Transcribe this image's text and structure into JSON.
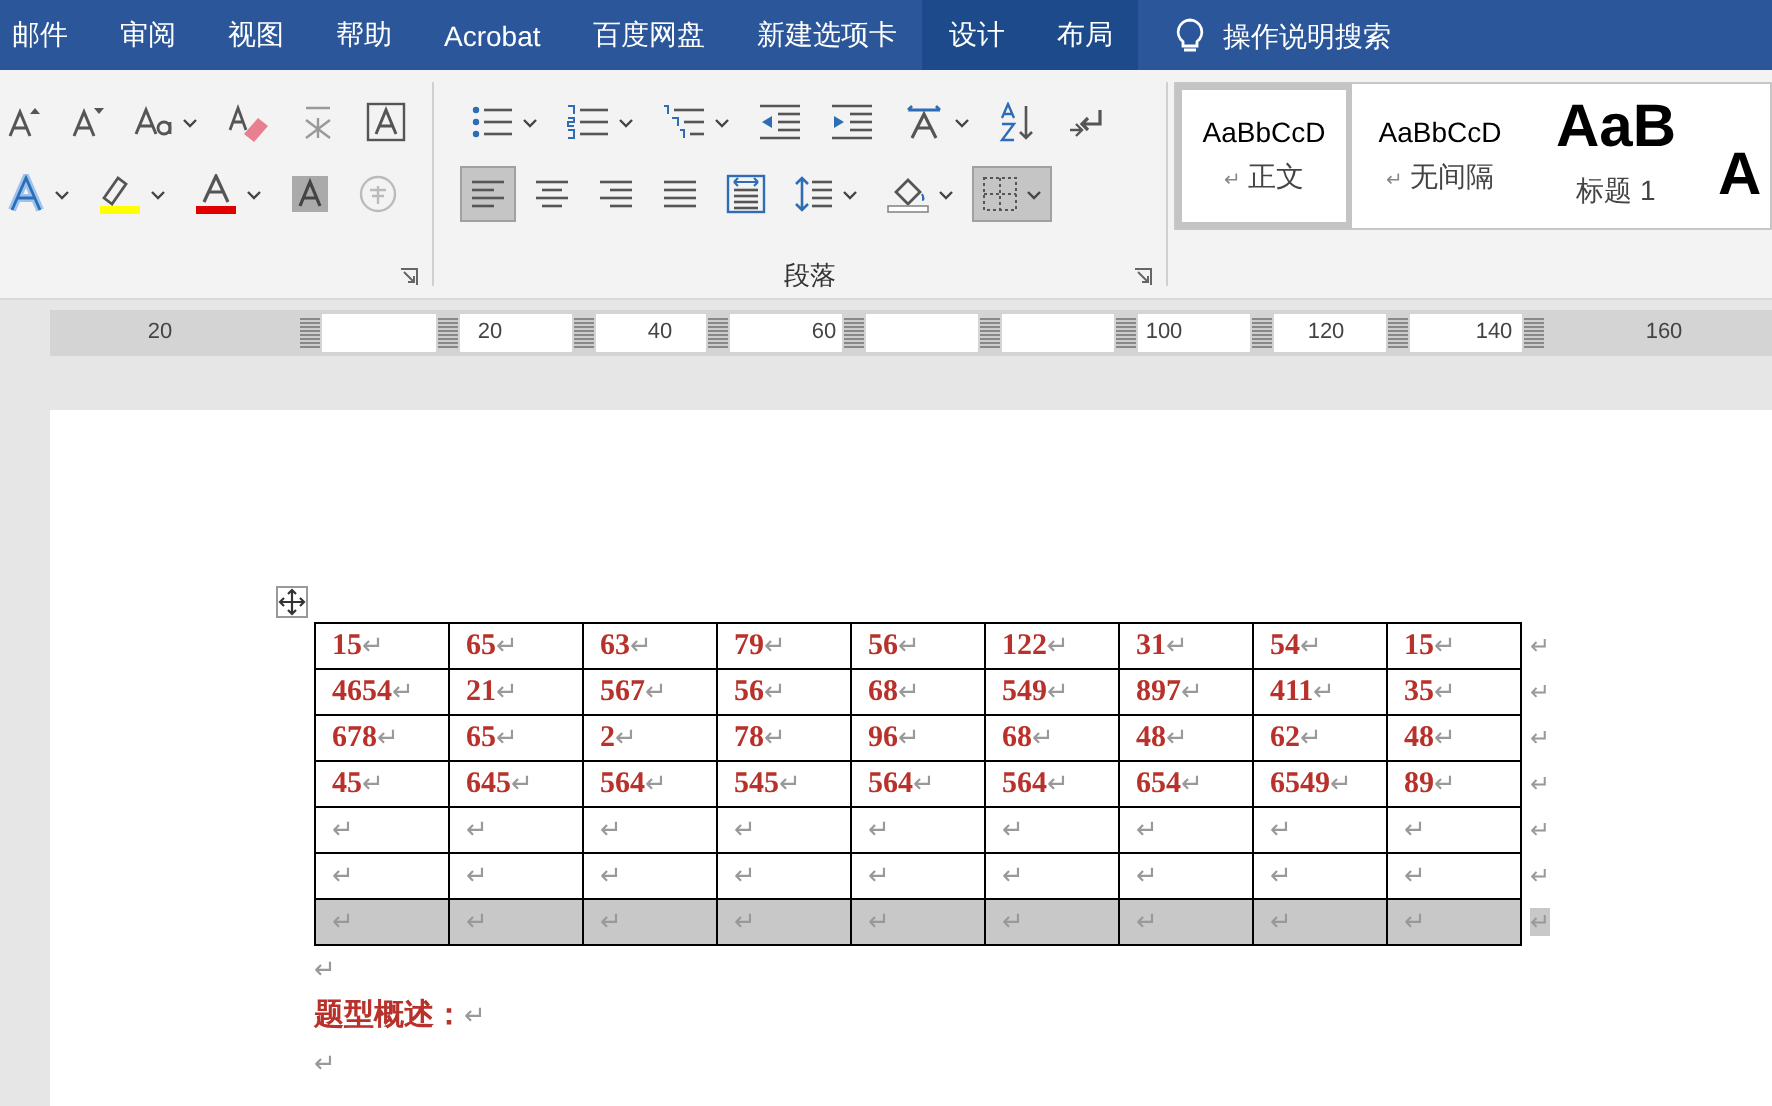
{
  "tabs": [
    {
      "label": "邮件",
      "kind": "normal"
    },
    {
      "label": "审阅",
      "kind": "normal"
    },
    {
      "label": "视图",
      "kind": "normal"
    },
    {
      "label": "帮助",
      "kind": "normal"
    },
    {
      "label": "Acrobat",
      "kind": "normal"
    },
    {
      "label": "百度网盘",
      "kind": "normal"
    },
    {
      "label": "新建选项卡",
      "kind": "normal"
    },
    {
      "label": "设计",
      "kind": "contextual"
    },
    {
      "label": "布局",
      "kind": "contextual"
    }
  ],
  "search": {
    "placeholder": "操作说明搜索"
  },
  "font_group": {
    "buttons": [
      {
        "pressed": false
      },
      {
        "pressed": false
      },
      {
        "pressed": false
      },
      {
        "pressed": false
      },
      {
        "pressed": false
      },
      {
        "pressed": false
      },
      {
        "pressed": false
      },
      {
        "pressed": false
      },
      {
        "pressed": false
      },
      {
        "pressed": false
      },
      {
        "pressed": false
      }
    ]
  },
  "paragraph_group": {
    "label": "段落",
    "buttons": [
      {
        "pressed": false
      },
      {
        "pressed": false
      },
      {
        "pressed": false
      },
      {
        "pressed": false
      },
      {
        "pressed": false
      },
      {
        "pressed": false
      },
      {
        "pressed": false
      },
      {
        "pressed": false
      },
      {
        "pressed": true
      },
      {
        "pressed": false
      },
      {
        "pressed": false
      },
      {
        "pressed": false
      },
      {
        "pressed": false
      },
      {
        "pressed": false
      },
      {
        "pressed": false
      },
      {
        "pressed": true
      }
    ]
  },
  "styles": [
    {
      "preview": "AaBbCcD",
      "label": "正文",
      "mark": "↵",
      "kind": "body",
      "selected": true
    },
    {
      "preview": "AaBbCcD",
      "label": "无间隔",
      "mark": "↵",
      "kind": "body",
      "selected": false
    },
    {
      "preview": "AaB",
      "label": "标题 1",
      "kind": "heading",
      "selected": false
    },
    {
      "preview": "A",
      "kind": "heading",
      "selected": false
    }
  ],
  "ruler": {
    "labels": [
      "20",
      "20",
      "40",
      "60",
      "100",
      "120",
      "140",
      "160"
    ]
  },
  "table": {
    "rows": [
      {
        "selected": false,
        "end_mark": "↵",
        "cells": [
          {
            "text": "15",
            "mark": "↵"
          },
          {
            "text": "65",
            "mark": "↵"
          },
          {
            "text": "63",
            "mark": "↵"
          },
          {
            "text": "79",
            "mark": "↵"
          },
          {
            "text": "56",
            "mark": "↵"
          },
          {
            "text": "122",
            "mark": "↵"
          },
          {
            "text": "31",
            "mark": "↵"
          },
          {
            "text": "54",
            "mark": "↵"
          },
          {
            "text": "15",
            "mark": "↵"
          }
        ]
      },
      {
        "selected": false,
        "end_mark": "↵",
        "cells": [
          {
            "text": "4654",
            "mark": "↵"
          },
          {
            "text": "21",
            "mark": "↵"
          },
          {
            "text": "567",
            "mark": "↵"
          },
          {
            "text": "56",
            "mark": "↵"
          },
          {
            "text": "68",
            "mark": "↵"
          },
          {
            "text": "549",
            "mark": "↵"
          },
          {
            "text": "897",
            "mark": "↵"
          },
          {
            "text": "411",
            "mark": "↵"
          },
          {
            "text": "35",
            "mark": "↵"
          }
        ]
      },
      {
        "selected": false,
        "end_mark": "↵",
        "cells": [
          {
            "text": "678",
            "mark": "↵"
          },
          {
            "text": "65",
            "mark": "↵"
          },
          {
            "text": "2",
            "mark": "↵"
          },
          {
            "text": "78",
            "mark": "↵"
          },
          {
            "text": "96",
            "mark": "↵"
          },
          {
            "text": "68",
            "mark": "↵"
          },
          {
            "text": "48",
            "mark": "↵"
          },
          {
            "text": "62",
            "mark": "↵"
          },
          {
            "text": "48",
            "mark": "↵"
          }
        ]
      },
      {
        "selected": false,
        "end_mark": "↵",
        "cells": [
          {
            "text": "45",
            "mark": "↵"
          },
          {
            "text": "645",
            "mark": "↵"
          },
          {
            "text": "564",
            "mark": "↵"
          },
          {
            "text": "545",
            "mark": "↵"
          },
          {
            "text": "564",
            "mark": "↵"
          },
          {
            "text": "564",
            "mark": "↵"
          },
          {
            "text": "654",
            "mark": "↵"
          },
          {
            "text": "6549",
            "mark": "↵"
          },
          {
            "text": "89",
            "mark": "↵"
          }
        ]
      },
      {
        "selected": false,
        "end_mark": "↵",
        "cells": [
          {
            "mark": "↵"
          },
          {
            "mark": "↵"
          },
          {
            "mark": "↵"
          },
          {
            "mark": "↵"
          },
          {
            "mark": "↵"
          },
          {
            "mark": "↵"
          },
          {
            "mark": "↵"
          },
          {
            "mark": "↵"
          },
          {
            "mark": "↵"
          }
        ]
      },
      {
        "selected": false,
        "end_mark": "↵",
        "cells": [
          {
            "mark": "↵"
          },
          {
            "mark": "↵"
          },
          {
            "mark": "↵"
          },
          {
            "mark": "↵"
          },
          {
            "mark": "↵"
          },
          {
            "mark": "↵"
          },
          {
            "mark": "↵"
          },
          {
            "mark": "↵"
          },
          {
            "mark": "↵"
          }
        ]
      },
      {
        "selected": true,
        "end_mark": "↵",
        "cells": [
          {
            "mark": "↵"
          },
          {
            "mark": "↵"
          },
          {
            "mark": "↵"
          },
          {
            "mark": "↵"
          },
          {
            "mark": "↵"
          },
          {
            "mark": "↵"
          },
          {
            "mark": "↵"
          },
          {
            "mark": "↵"
          },
          {
            "mark": "↵"
          }
        ]
      }
    ]
  },
  "paragraphs": [
    {
      "mark": "↵"
    },
    {
      "text": "题型概述：",
      "mark": "↵"
    },
    {
      "mark": "↵"
    }
  ]
}
